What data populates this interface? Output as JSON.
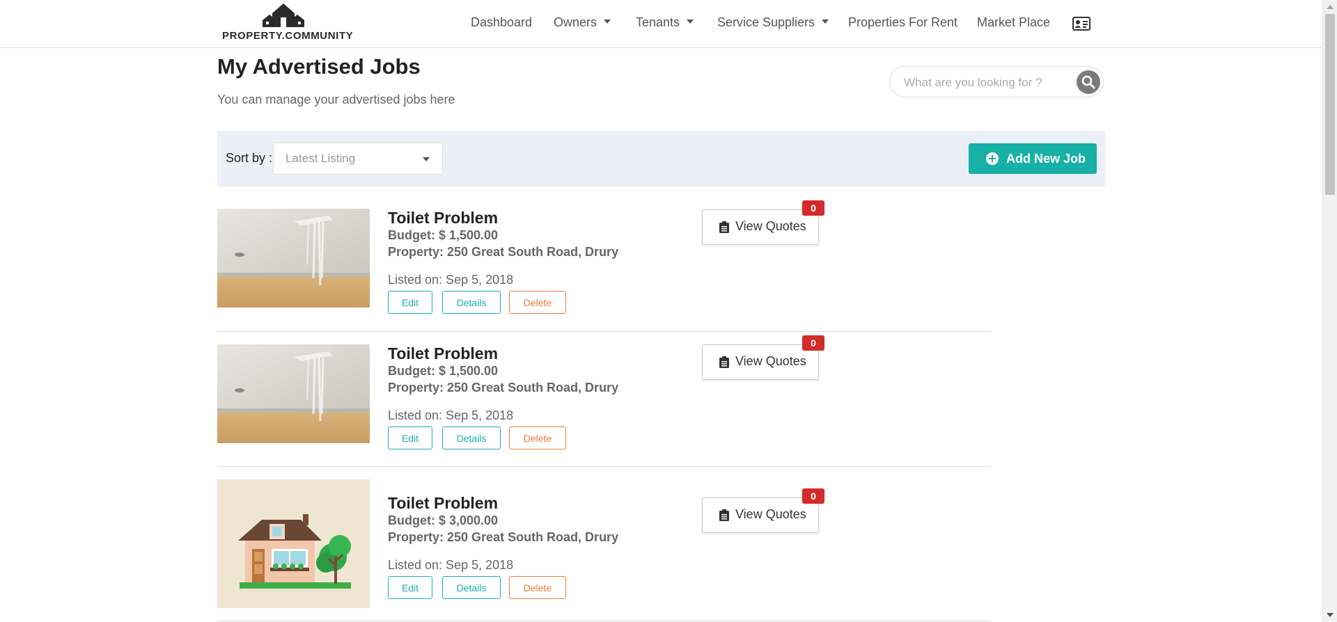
{
  "brand": {
    "name": "PROPERTY.COMMUNITY"
  },
  "nav": {
    "dashboard": "Dashboard",
    "owners": "Owners",
    "tenants": "Tenants",
    "service_suppliers": "Service Suppliers",
    "properties_for_rent": "Properties For Rent",
    "market_place": "Market Place"
  },
  "page": {
    "title": "My Advertised Jobs",
    "subtitle": "You can manage your advertised jobs here"
  },
  "search": {
    "placeholder": "What are you looking for ?"
  },
  "filters": {
    "sort_label": "Sort by :",
    "sort_value": "Latest Listing",
    "add_button": "Add New Job"
  },
  "jobs": [
    {
      "title": "Toilet Problem",
      "budget": "Budget: $ 1,500.00",
      "property": "Property: 250 Great South Road, Drury",
      "listed": "Listed on: Sep 5, 2018",
      "quotes_label": "View Quotes",
      "quotes_count": "0",
      "edit": "Edit",
      "details": "Details",
      "delete": "Delete",
      "image": "ceiling-leak-photo"
    },
    {
      "title": "Toilet Problem",
      "budget": "Budget: $ 1,500.00",
      "property": "Property: 250 Great South Road, Drury",
      "listed": "Listed on: Sep 5, 2018",
      "quotes_label": "View Quotes",
      "quotes_count": "0",
      "edit": "Edit",
      "details": "Details",
      "delete": "Delete",
      "image": "ceiling-leak-photo"
    },
    {
      "title": "Toilet Problem",
      "budget": "Budget: $ 3,000.00",
      "property": "Property: 250 Great South Road, Drury",
      "listed": "Listed on: Sep 5, 2018",
      "quotes_label": "View Quotes",
      "quotes_count": "0",
      "edit": "Edit",
      "details": "Details",
      "delete": "Delete",
      "image": "house-illustration"
    }
  ],
  "colors": {
    "accent": "#17b0a7",
    "danger": "#d32a2a",
    "delete": "#f07a3a",
    "filter_bg": "#ebeff7"
  }
}
